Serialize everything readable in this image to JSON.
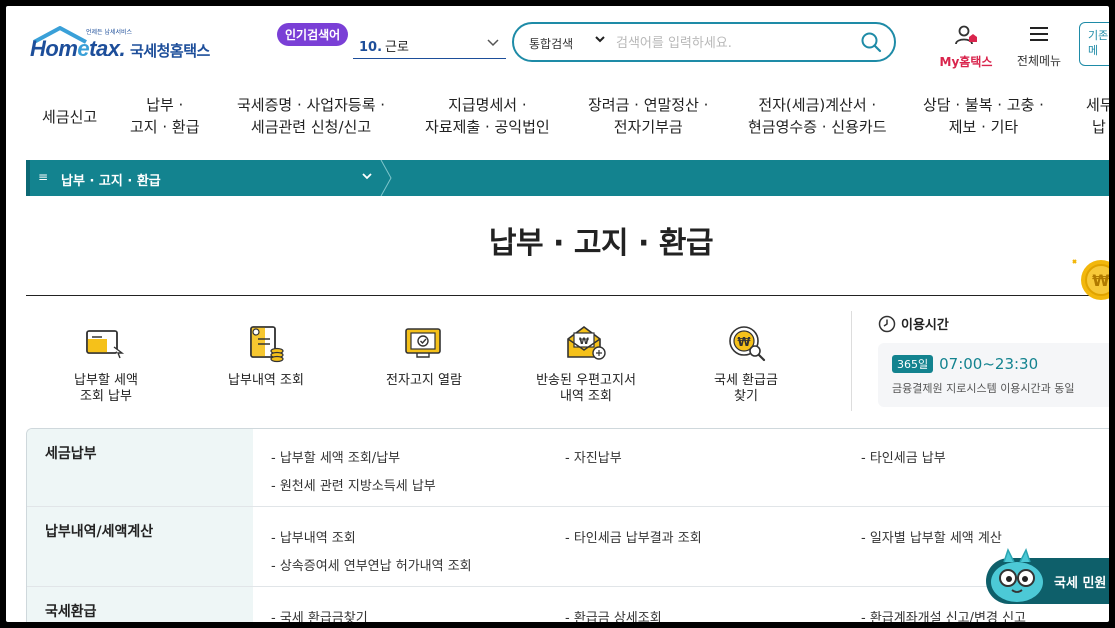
{
  "header": {
    "logo_small": "언제든 납세서비스",
    "logo_text": "Hometax.",
    "logo_sub": "국세청홈택스",
    "popular_badge": "인기검색어",
    "popular_num": "10.",
    "popular_term": "근로",
    "search_scope": "통합검색",
    "search_placeholder": "검색어를 입력하세요.",
    "my_label": "My홈택스",
    "all_menu_label": "전체메뉴",
    "extra_btn_line1": "기존",
    "extra_btn_line2": "메"
  },
  "gnb": {
    "items": [
      {
        "l1": "세금신고",
        "l2": ""
      },
      {
        "l1": "납부 ·",
        "l2": "고지 · 환급"
      },
      {
        "l1": "국세증명 · 사업자등록 ·",
        "l2": "세금관련 신청/신고"
      },
      {
        "l1": "지급명세서 ·",
        "l2": "자료제출 · 공익법인"
      },
      {
        "l1": "장려금 · 연말정산 ·",
        "l2": "전자기부금"
      },
      {
        "l1": "전자(세금)계산서 ·",
        "l2": "현금영수증 · 신용카드"
      },
      {
        "l1": "상담 · 불복 · 고충 ·",
        "l2": "제보 · 기타"
      },
      {
        "l1": "세무",
        "l2": "납"
      }
    ]
  },
  "breadcrumb": {
    "menu_icon": "≡",
    "label": "납부 · 고지 · 환급"
  },
  "page_title": "납부 · 고지 · 환급",
  "quick_menu": [
    {
      "l1": "납부할 세액",
      "l2": "조회 납부",
      "icon": "payment-icon"
    },
    {
      "l1": "납부내역 조회",
      "l2": "",
      "icon": "payment-history-icon"
    },
    {
      "l1": "전자고지 열람",
      "l2": "",
      "icon": "e-notice-icon"
    },
    {
      "l1": "반송된 우편고지서",
      "l2": "내역 조회",
      "icon": "returned-mail-icon"
    },
    {
      "l1": "국세 환급금",
      "l2": "찾기",
      "icon": "refund-search-icon"
    }
  ],
  "hours": {
    "title": "이용시간",
    "badge": "365일",
    "time": "07:00~23:30",
    "note": "금융결제원 지로시스템 이용시간과 동일"
  },
  "sections": [
    {
      "category": "세금납부",
      "links": [
        "- 납부할 세액 조회/납부",
        "- 자진납부",
        "- 타인세금 납부",
        "- 원천세 관련 지방소득세 납부"
      ]
    },
    {
      "category": "납부내역/세액계산",
      "links": [
        "- 납부내역 조회",
        "- 타인세금 납부결과 조회",
        "- 일자별 납부할 세액 계산",
        "- 상속증여세 연부연납 허가내역 조회"
      ]
    },
    {
      "category": "국세환급",
      "links": [
        "- 국세 환급금찾기",
        "- 환급금 상세조회",
        "- 환급계좌개설 신고/변경 신고"
      ]
    }
  ],
  "chatbot": {
    "label": "국세 민원"
  },
  "colors": {
    "teal": "#13838f",
    "brand_blue": "#1d4e9a",
    "accent_red": "#d9244c",
    "badge_purple": "#7a3fd6"
  }
}
